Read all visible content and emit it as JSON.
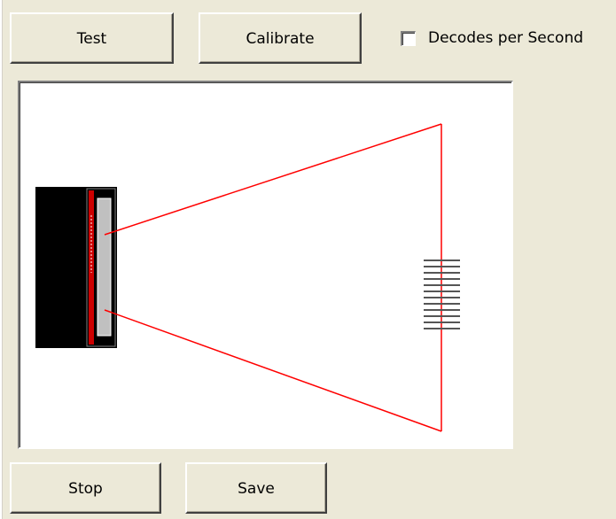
{
  "toolbar": {
    "test_label": "Test",
    "calibrate_label": "Calibrate",
    "decodes_per_second_label": "Decodes per Second",
    "decodes_per_second_checked": false
  },
  "preview": {
    "scanner_icon": "barcode-scanner-icon",
    "barcode_icon": "barcode-icon",
    "field_of_view_color": "#ff0000"
  },
  "footer": {
    "stop_label": "Stop",
    "save_label": "Save"
  }
}
